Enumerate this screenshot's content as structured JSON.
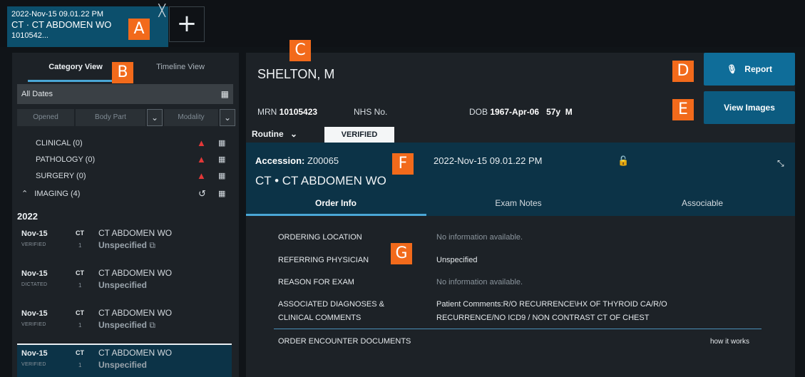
{
  "tab": {
    "timestamp": "2022-Nov-15 09.01.22 PM",
    "title": "CT · CT ABDOMEN WO",
    "id": "1010542...",
    "close_glyph": "╳",
    "add_glyph": "+"
  },
  "markers": [
    "A",
    "B",
    "C",
    "D",
    "E",
    "F",
    "G"
  ],
  "left_panel": {
    "views": [
      "Category View",
      "Timeline View"
    ],
    "date_filter": "All Dates",
    "filters": [
      "Opened",
      "Body Part",
      "Modality"
    ],
    "categories": [
      {
        "label": "CLINICAL (0)"
      },
      {
        "label": "PATHOLOGY (0)"
      },
      {
        "label": "SURGERY (0)"
      }
    ],
    "imaging_label": "IMAGING (4)",
    "year": "2022",
    "exams": [
      {
        "date": "Nov-15",
        "status": "VERIFIED",
        "modality": "CT",
        "count": "1",
        "description": "CT ABDOMEN WO",
        "body_part": "Unspecified"
      },
      {
        "date": "Nov-15",
        "status": "DICTATED",
        "modality": "CT",
        "count": "1",
        "description": "CT ABDOMEN WO",
        "body_part": "Unspecified"
      },
      {
        "date": "Nov-15",
        "status": "VERIFIED",
        "modality": "CT",
        "count": "1",
        "description": "CT ABDOMEN WO",
        "body_part": "Unspecified"
      },
      {
        "date": "Nov-15",
        "status": "VERIFIED",
        "modality": "CT",
        "count": "1",
        "description": "CT ABDOMEN WO",
        "body_part": "Unspecified"
      }
    ]
  },
  "patient": {
    "name": "SHELTON, M",
    "mrn_label": "MRN",
    "mrn": "10105423",
    "nhs_label": "NHS No.",
    "dob_label": "DOB",
    "dob": "1967-Apr-06",
    "age": "57y",
    "sex": "M"
  },
  "actions": {
    "report": "Report",
    "view_images": "View Images"
  },
  "order": {
    "priority": "Routine",
    "status": "VERIFIED",
    "accession_label": "Accession:",
    "accession": "Z00065",
    "datetime": "2022-Nov-15 09.01.22 PM",
    "procedure": "CT  •  CT ABDOMEN WO",
    "tabs": [
      "Order Info",
      "Exam Notes",
      "Associable"
    ]
  },
  "order_info": [
    {
      "label": "ORDERING LOCATION",
      "value": "No information available."
    },
    {
      "label": "REFERRING PHYSICIAN",
      "value": "Unspecified"
    },
    {
      "label": "REASON FOR EXAM",
      "value": "No information available."
    },
    {
      "label": "ASSOCIATED DIAGNOSES &",
      "label2": "CLINICAL COMMENTS",
      "value": "Patient Comments:R/O RECURRENCE\\HX OF THYROID CA/R/O",
      "value2": "RECURRENCE/NO ICD9 / NON CONTRAST CT OF CHEST"
    },
    {
      "label": "ORDER ENCOUNTER DOCUMENTS",
      "value": ""
    }
  ],
  "how_it_works": "how it works",
  "colors": {
    "accent": "#4aa7d6",
    "button": "#0f6d99",
    "marker": "#f26a1b",
    "warning": "#e23838",
    "selected_row": "#0c3347"
  }
}
